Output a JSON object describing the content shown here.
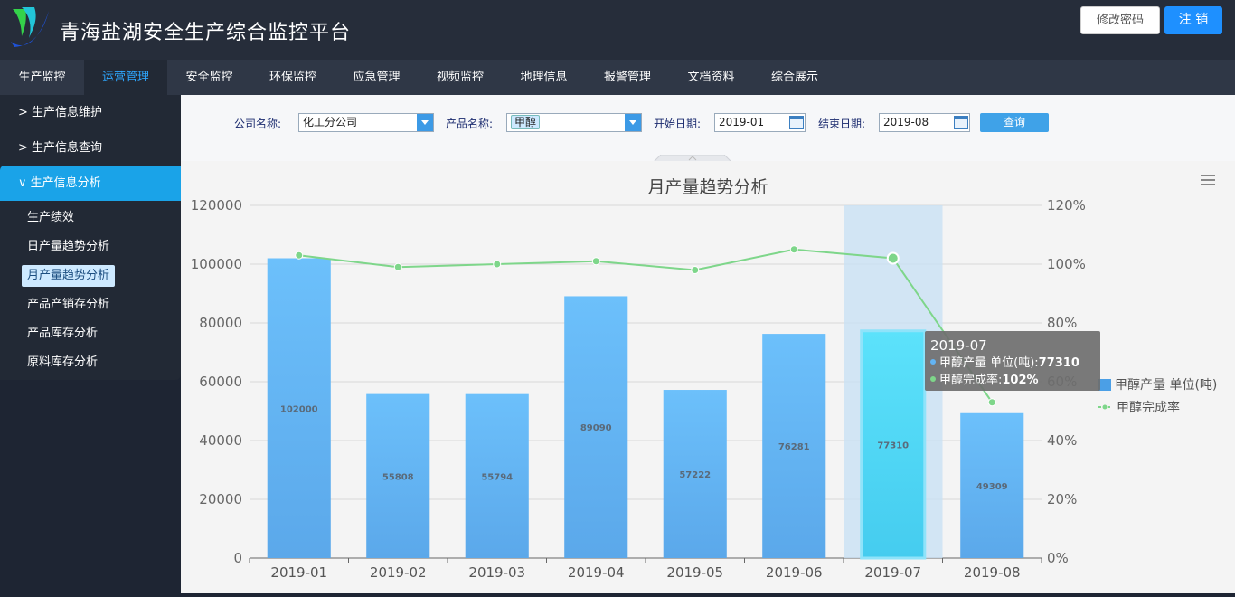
{
  "header": {
    "title": "青海盐湖安全生产综合监控平台",
    "btn_change_password": "修改密码",
    "btn_logout": "注 销"
  },
  "topnav": {
    "items": [
      {
        "label": "生产监控"
      },
      {
        "label": "运营管理",
        "active": true
      },
      {
        "label": "安全监控"
      },
      {
        "label": "环保监控"
      },
      {
        "label": "应急管理"
      },
      {
        "label": "视频监控"
      },
      {
        "label": "地理信息"
      },
      {
        "label": "报警管理"
      },
      {
        "label": "文档资料"
      },
      {
        "label": "综合展示"
      }
    ]
  },
  "sidebar": {
    "groups": [
      {
        "label": "生产信息维护",
        "expanded": false
      },
      {
        "label": "生产信息查询",
        "expanded": false
      },
      {
        "label": "生产信息分析",
        "expanded": true
      }
    ],
    "subitems": [
      {
        "label": "生产绩效"
      },
      {
        "label": "日产量趋势分析"
      },
      {
        "label": "月产量趋势分析",
        "active": true
      },
      {
        "label": "产品产销存分析"
      },
      {
        "label": "产品库存分析"
      },
      {
        "label": "原料库存分析"
      }
    ]
  },
  "filters": {
    "company_label": "公司名称:",
    "company_value": "化工分公司",
    "product_label": "产品名称:",
    "product_value": "甲醇",
    "start_label": "开始日期:",
    "start_value": "2019-01",
    "end_label": "结束日期:",
    "end_value": "2019-08",
    "query_button": "查询"
  },
  "colors": {
    "accent": "#1e90ff",
    "bar": "#66b7f5",
    "bar_highlight": "#4fd2f5",
    "line": "#7ed68a"
  },
  "chart_data": {
    "type": "bar",
    "title": "月产量趋势分析",
    "categories": [
      "2019-01",
      "2019-02",
      "2019-03",
      "2019-04",
      "2019-05",
      "2019-06",
      "2019-07",
      "2019-08"
    ],
    "series": [
      {
        "name": "甲醇产量 单位(吨)",
        "type": "bar",
        "axis": "left",
        "values": [
          102000,
          55808,
          55794,
          89090,
          57222,
          76281,
          77310,
          49309
        ]
      },
      {
        "name": "甲醇完成率",
        "type": "line",
        "axis": "right",
        "values": [
          103,
          99,
          100,
          101,
          98,
          105,
          102,
          53
        ]
      }
    ],
    "y_left": {
      "min": 0,
      "max": 120000,
      "ticks": [
        "0",
        "20000",
        "40000",
        "60000",
        "80000",
        "100000",
        "120000"
      ]
    },
    "y_right": {
      "min": 0,
      "max": 120,
      "ticks": [
        "0%",
        "20%",
        "40%",
        "60%",
        "80%",
        "100%",
        "120%"
      ]
    },
    "legend_position": "right",
    "grid": true,
    "tooltip": {
      "title": "2019-07",
      "line1_label": "甲醇产量 单位(吨):",
      "line1_value": "77310",
      "line2_label": "甲醇完成率:",
      "line2_value": "102%"
    },
    "highlight_index": 6
  }
}
